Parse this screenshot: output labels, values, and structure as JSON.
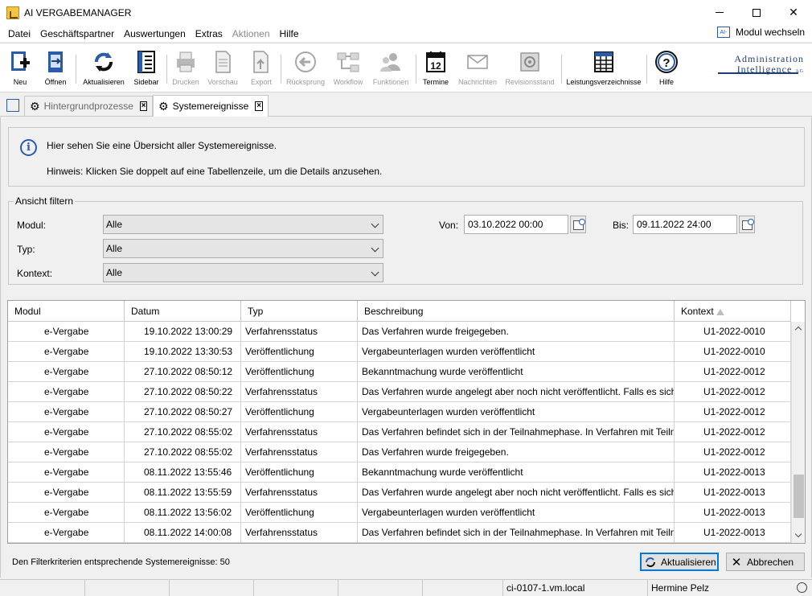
{
  "window": {
    "title": "AI VERGABEMANAGER"
  },
  "menu": {
    "items": [
      {
        "label": "Datei",
        "disabled": false
      },
      {
        "label": "Geschäftspartner",
        "disabled": false
      },
      {
        "label": "Auswertungen",
        "disabled": false
      },
      {
        "label": "Extras",
        "disabled": false
      },
      {
        "label": "Aktionen",
        "disabled": true
      },
      {
        "label": "Hilfe",
        "disabled": false
      }
    ],
    "modul_wechseln": "Modul wechseln",
    "modul_icon_text": "AI-"
  },
  "toolbar": {
    "neu": "Neu",
    "oeffnen": "Öffnen",
    "aktualisieren": "Aktualisieren",
    "sidebar": "Sidebar",
    "drucken": "Drucken",
    "vorschau": "Vorschau",
    "export": "Export",
    "ruecksprung": "Rücksprung",
    "workflow": "Workflow",
    "funktionen": "Funktionen",
    "termine": "Termine",
    "termine_day": "12",
    "nachrichten": "Nachrichten",
    "revisionsstand": "Revisionsstand",
    "leistungsverzeichnisse": "Leistungsverzeichnisse",
    "hilfe": "Hilfe",
    "logo_line1": "Administration",
    "logo_line2": "Intelligence",
    "logo_ag": "AG",
    "accent": "#2a5aa8"
  },
  "tabs": [
    {
      "label": "Hintergrundprozesse",
      "active": false
    },
    {
      "label": "Systemereignisse",
      "active": true
    }
  ],
  "info": {
    "line1": "Hier sehen Sie eine Übersicht aller Systemereignisse.",
    "line2": "Hinweis: Klicken Sie doppelt auf eine Tabellenzeile, um die Details anzusehen."
  },
  "filter": {
    "legend": "Ansicht filtern",
    "modul_label": "Modul:",
    "modul_value": "Alle",
    "typ_label": "Typ:",
    "typ_value": "Alle",
    "kontext_label": "Kontext:",
    "kontext_value": "Alle",
    "von_label": "Von:",
    "von_value": "03.10.2022 00:00",
    "bis_label": "Bis:",
    "bis_value": "09.11.2022 24:00"
  },
  "table": {
    "columns": [
      "Modul",
      "Datum",
      "Typ",
      "Beschreibung",
      "Kontext"
    ],
    "rows": [
      [
        "e-Vergabe",
        "19.10.2022 13:00:29",
        "Verfahrensstatus",
        "Das Verfahren wurde freigegeben.",
        "U1-2022-0010"
      ],
      [
        "e-Vergabe",
        "19.10.2022 13:30:53",
        "Veröffentlichung",
        "Vergabeunterlagen wurden veröffentlicht",
        "U1-2022-0010"
      ],
      [
        "e-Vergabe",
        "27.10.2022 08:50:12",
        "Veröffentlichung",
        "Bekanntmachung wurde veröffentlicht",
        "U1-2022-0012"
      ],
      [
        "e-Vergabe",
        "27.10.2022 08:50:22",
        "Verfahrensstatus",
        "Das Verfahren wurde angelegt aber noch nicht veröffentlicht. Falls es sich",
        "U1-2022-0012"
      ],
      [
        "e-Vergabe",
        "27.10.2022 08:50:27",
        "Veröffentlichung",
        "Vergabeunterlagen wurden veröffentlicht",
        "U1-2022-0012"
      ],
      [
        "e-Vergabe",
        "27.10.2022 08:55:02",
        "Verfahrensstatus",
        "Das Verfahren befindet sich in der Teilnahmephase. In Verfahren mit Teilna",
        "U1-2022-0012"
      ],
      [
        "e-Vergabe",
        "27.10.2022 08:55:02",
        "Verfahrensstatus",
        "Das Verfahren wurde freigegeben.",
        "U1-2022-0012"
      ],
      [
        "e-Vergabe",
        "08.11.2022 13:55:46",
        "Veröffentlichung",
        "Bekanntmachung wurde veröffentlicht",
        "U1-2022-0013"
      ],
      [
        "e-Vergabe",
        "08.11.2022 13:55:59",
        "Verfahrensstatus",
        "Das Verfahren wurde angelegt aber noch nicht veröffentlicht. Falls es sich",
        "U1-2022-0013"
      ],
      [
        "e-Vergabe",
        "08.11.2022 13:56:02",
        "Veröffentlichung",
        "Vergabeunterlagen wurden veröffentlicht",
        "U1-2022-0013"
      ],
      [
        "e-Vergabe",
        "08.11.2022 14:00:08",
        "Verfahrensstatus",
        "Das Verfahren befindet sich in der Teilnahmephase. In Verfahren mit Teilna",
        "U1-2022-0013"
      ]
    ]
  },
  "bottom": {
    "count_text": "Den Filterkriterien entsprechende Systemereignisse: 50",
    "refresh_button": "Aktualisieren",
    "cancel_button": "Abbrechen"
  },
  "status": {
    "server": "ci-0107-1.vm.local",
    "user": "Hermine Pelz"
  }
}
